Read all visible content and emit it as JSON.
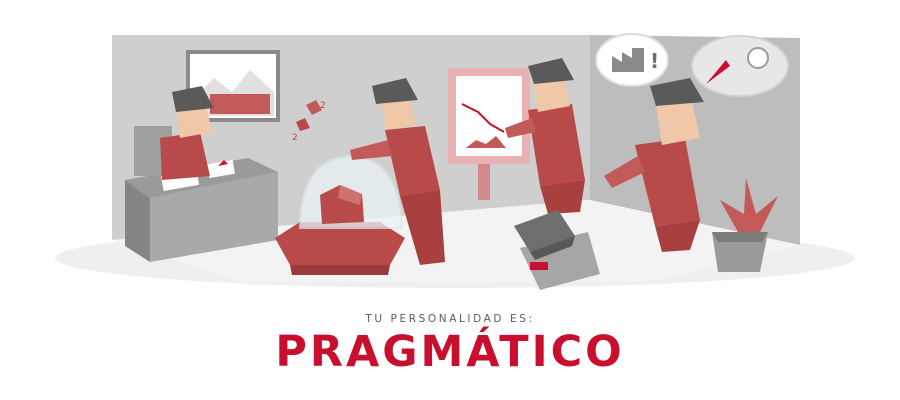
{
  "result": {
    "subtitle": "TU PERSONALIDAD ES:",
    "title": "PRAGMÁTICO"
  },
  "illustration": {
    "thought_bubble_1_text": "!",
    "colors": {
      "brand_red": "#c8102e",
      "figure_red": "#b94a4a",
      "light_red": "#d98080",
      "wall_gray": "#c9c9c9",
      "floor_gray": "#ececec",
      "dark_gray": "#6e6e6e"
    }
  }
}
